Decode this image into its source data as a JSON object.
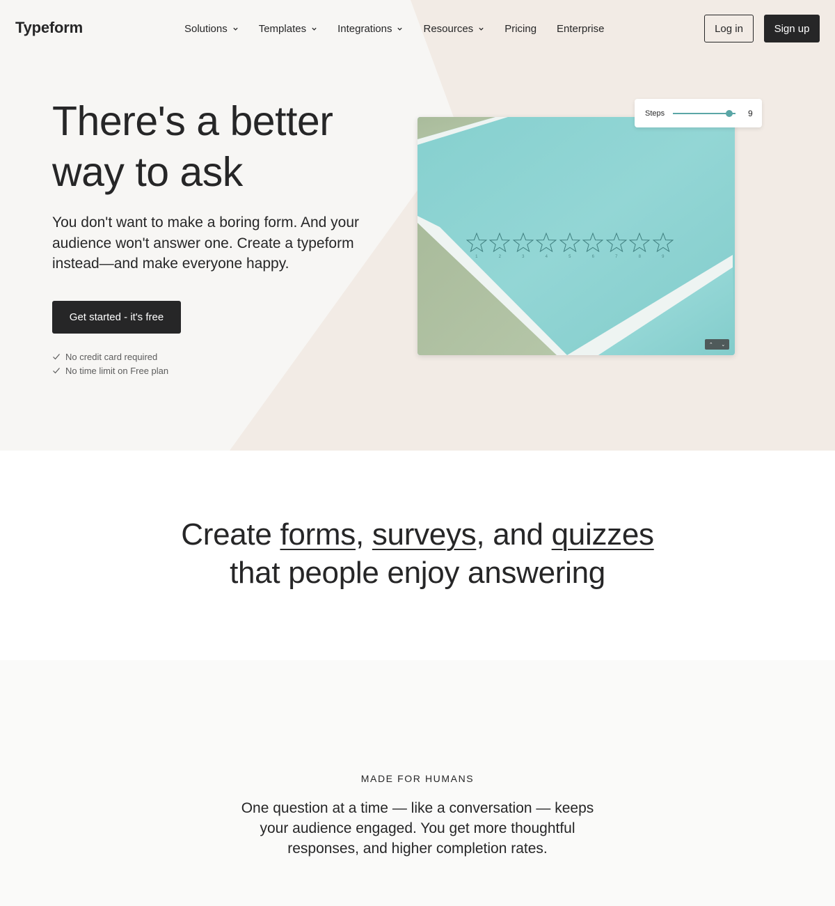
{
  "brand": {
    "logo": "Typeform"
  },
  "nav": {
    "items": [
      {
        "label": "Solutions",
        "dropdown": true
      },
      {
        "label": "Templates",
        "dropdown": true
      },
      {
        "label": "Integrations",
        "dropdown": true
      },
      {
        "label": "Resources",
        "dropdown": true
      },
      {
        "label": "Pricing",
        "dropdown": false
      },
      {
        "label": "Enterprise",
        "dropdown": false
      }
    ],
    "login_label": "Log in",
    "signup_label": "Sign up"
  },
  "hero": {
    "title": "There's a better way to ask",
    "subtitle": "You don't want to make a boring form. And your audience won't answer one. Create a typeform instead—and make everyone happy.",
    "cta_label": "Get started - it's free",
    "checks": [
      "No credit card required",
      "No time limit on Free plan"
    ]
  },
  "preview": {
    "steps_label": "Steps",
    "steps_value": "9",
    "steps_fraction": 0.9,
    "star_numbers": [
      "1",
      "2",
      "3",
      "4",
      "5",
      "6",
      "7",
      "8",
      "9"
    ],
    "arrow_up_icon": "chevron-up-icon",
    "arrow_down_icon": "chevron-down-icon"
  },
  "features": {
    "title_prefix": "Create ",
    "link_forms": "forms",
    "sep1": ", ",
    "link_surveys": "surveys",
    "sep2": ", and ",
    "link_quizzes": "quizzes",
    "title_suffix": " that people enjoy answering"
  },
  "humans": {
    "eyebrow": "MADE FOR HUMANS",
    "body": "One question at a time — like a conversation — keeps your audience engaged. You get more thoughtful responses, and higher completion rates."
  },
  "colors": {
    "ink": "#262627",
    "hero_bg": "#f7f6f4",
    "hero_accent": "#f2ebe5",
    "teal": "#8dd3d3",
    "sage": "#aebfa0"
  }
}
